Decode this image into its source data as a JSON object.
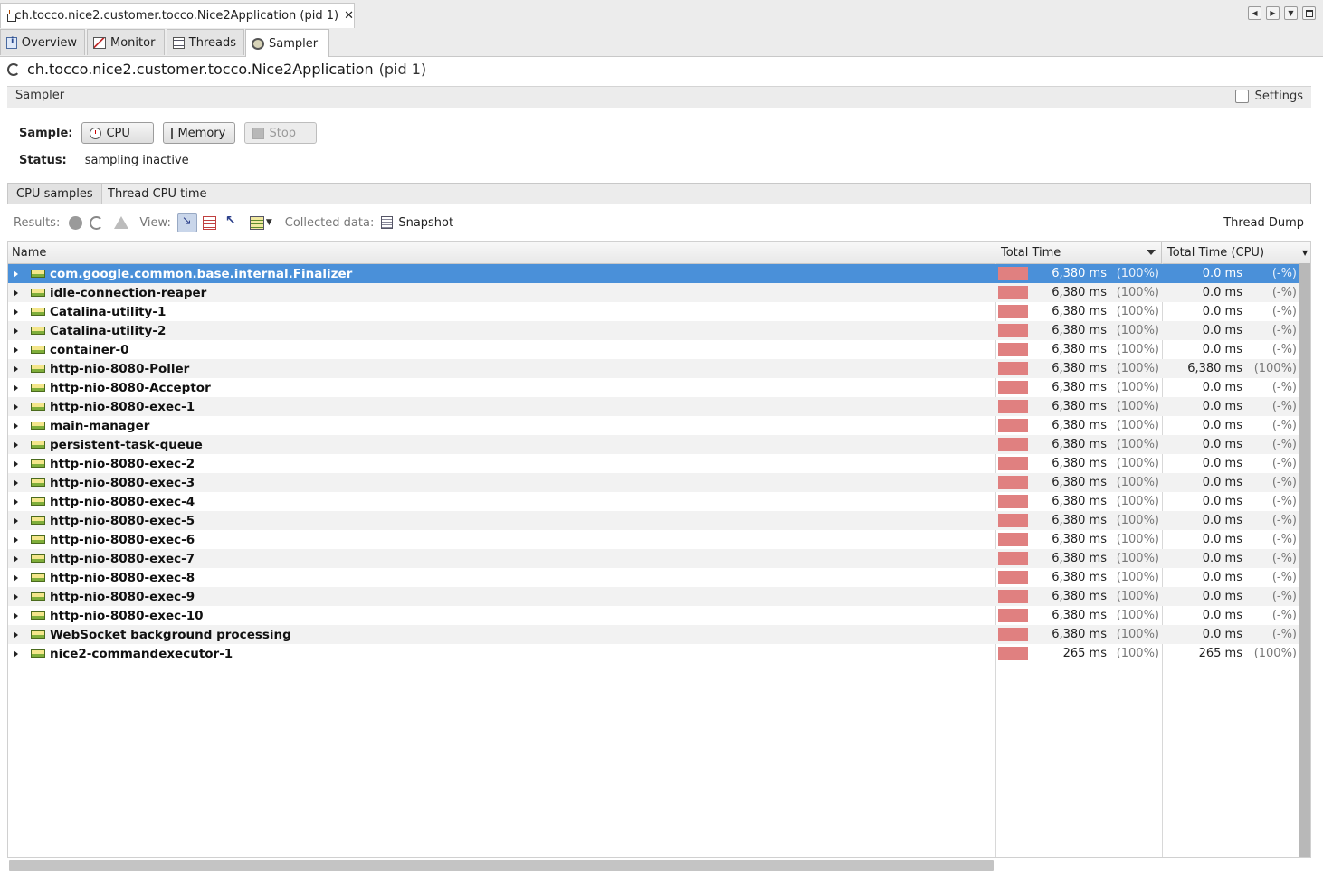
{
  "window": {
    "doc_tab_title": "ch.tocco.nice2.customer.tocco.Nice2Application (pid 1)",
    "close_glyph": "✕",
    "controls": [
      "◀",
      "▶",
      "▼",
      ""
    ]
  },
  "view_tabs": [
    {
      "label": "Overview",
      "icon": "overview-icon"
    },
    {
      "label": "Monitor",
      "icon": "monitor-icon"
    },
    {
      "label": "Threads",
      "icon": "threads-icon"
    },
    {
      "label": "Sampler",
      "icon": "sampler-icon",
      "active": true
    }
  ],
  "header": {
    "app_name": "ch.tocco.nice2.customer.tocco.Nice2Application",
    "pid": "(pid 1)"
  },
  "sampler_bar": {
    "label": "Sampler",
    "settings_label": "Settings",
    "settings_checked": false
  },
  "sample": {
    "label": "Sample:",
    "cpu_label": "CPU",
    "memory_label": "Memory",
    "stop_label": "Stop",
    "stop_enabled": false
  },
  "status": {
    "label": "Status:",
    "value": "sampling inactive"
  },
  "inner_tabs": [
    {
      "label": "CPU samples",
      "active": true
    },
    {
      "label": "Thread CPU time"
    }
  ],
  "toolbar": {
    "results_label": "Results:",
    "view_label": "View:",
    "collected_label": "Collected data:",
    "snapshot_label": "Snapshot",
    "thread_dump_label": "Thread Dump"
  },
  "table": {
    "columns": [
      "Name",
      "Total Time",
      "Total Time (CPU)"
    ],
    "sorted_column": "Total Time",
    "bar_color": "#e08080",
    "selection_color": "#4a90d9",
    "rows": [
      {
        "name": "com.google.common.base.internal.Finalizer",
        "total": "6,380 ms",
        "total_pct": "(100%)",
        "cpu": "0.0 ms",
        "cpu_pct": "(-%)",
        "selected": true
      },
      {
        "name": "idle-connection-reaper",
        "total": "6,380 ms",
        "total_pct": "(100%)",
        "cpu": "0.0 ms",
        "cpu_pct": "(-%)"
      },
      {
        "name": "Catalina-utility-1",
        "total": "6,380 ms",
        "total_pct": "(100%)",
        "cpu": "0.0 ms",
        "cpu_pct": "(-%)"
      },
      {
        "name": "Catalina-utility-2",
        "total": "6,380 ms",
        "total_pct": "(100%)",
        "cpu": "0.0 ms",
        "cpu_pct": "(-%)"
      },
      {
        "name": "container-0",
        "total": "6,380 ms",
        "total_pct": "(100%)",
        "cpu": "0.0 ms",
        "cpu_pct": "(-%)"
      },
      {
        "name": "http-nio-8080-Poller",
        "total": "6,380 ms",
        "total_pct": "(100%)",
        "cpu": "6,380 ms",
        "cpu_pct": "(100%)"
      },
      {
        "name": "http-nio-8080-Acceptor",
        "total": "6,380 ms",
        "total_pct": "(100%)",
        "cpu": "0.0 ms",
        "cpu_pct": "(-%)"
      },
      {
        "name": "http-nio-8080-exec-1",
        "total": "6,380 ms",
        "total_pct": "(100%)",
        "cpu": "0.0 ms",
        "cpu_pct": "(-%)"
      },
      {
        "name": "main-manager",
        "total": "6,380 ms",
        "total_pct": "(100%)",
        "cpu": "0.0 ms",
        "cpu_pct": "(-%)"
      },
      {
        "name": "persistent-task-queue",
        "total": "6,380 ms",
        "total_pct": "(100%)",
        "cpu": "0.0 ms",
        "cpu_pct": "(-%)"
      },
      {
        "name": "http-nio-8080-exec-2",
        "total": "6,380 ms",
        "total_pct": "(100%)",
        "cpu": "0.0 ms",
        "cpu_pct": "(-%)"
      },
      {
        "name": "http-nio-8080-exec-3",
        "total": "6,380 ms",
        "total_pct": "(100%)",
        "cpu": "0.0 ms",
        "cpu_pct": "(-%)"
      },
      {
        "name": "http-nio-8080-exec-4",
        "total": "6,380 ms",
        "total_pct": "(100%)",
        "cpu": "0.0 ms",
        "cpu_pct": "(-%)"
      },
      {
        "name": "http-nio-8080-exec-5",
        "total": "6,380 ms",
        "total_pct": "(100%)",
        "cpu": "0.0 ms",
        "cpu_pct": "(-%)"
      },
      {
        "name": "http-nio-8080-exec-6",
        "total": "6,380 ms",
        "total_pct": "(100%)",
        "cpu": "0.0 ms",
        "cpu_pct": "(-%)"
      },
      {
        "name": "http-nio-8080-exec-7",
        "total": "6,380 ms",
        "total_pct": "(100%)",
        "cpu": "0.0 ms",
        "cpu_pct": "(-%)"
      },
      {
        "name": "http-nio-8080-exec-8",
        "total": "6,380 ms",
        "total_pct": "(100%)",
        "cpu": "0.0 ms",
        "cpu_pct": "(-%)"
      },
      {
        "name": "http-nio-8080-exec-9",
        "total": "6,380 ms",
        "total_pct": "(100%)",
        "cpu": "0.0 ms",
        "cpu_pct": "(-%)"
      },
      {
        "name": "http-nio-8080-exec-10",
        "total": "6,380 ms",
        "total_pct": "(100%)",
        "cpu": "0.0 ms",
        "cpu_pct": "(-%)"
      },
      {
        "name": "WebSocket background processing",
        "total": "6,380 ms",
        "total_pct": "(100%)",
        "cpu": "0.0 ms",
        "cpu_pct": "(-%)"
      },
      {
        "name": "nice2-commandexecutor-1",
        "total": "265 ms",
        "total_pct": "(100%)",
        "cpu": "265 ms",
        "cpu_pct": "(100%)"
      }
    ]
  }
}
